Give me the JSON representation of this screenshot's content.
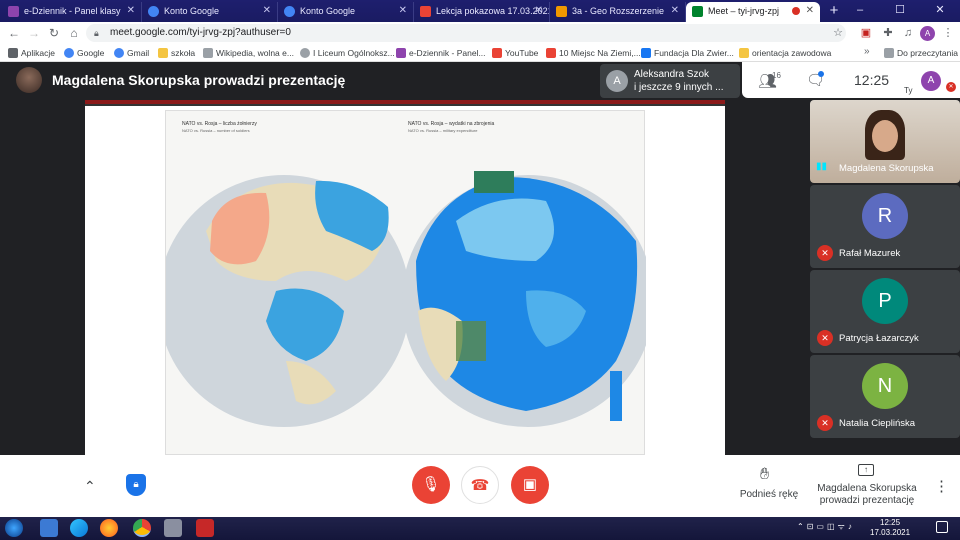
{
  "browser": {
    "tabs": [
      {
        "label": "e-Dziennik - Panel klasy",
        "color": "#8e44ad"
      },
      {
        "label": "Konto Google",
        "color": "#4285f4"
      },
      {
        "label": "Konto Google",
        "color": "#4285f4"
      },
      {
        "label": "Lekcja pokazowa 17.03.2021",
        "color": "#ea4335"
      },
      {
        "label": "3a - Geo Rozszerzenie",
        "color": "#f29900"
      },
      {
        "label": "Meet – tyi-jrvg-zpj",
        "color": "#00832d"
      }
    ],
    "new_tab": "+",
    "window_controls": {
      "minimize": "–",
      "maximize": "☐",
      "close": "✕"
    },
    "url": "meet.google.com/tyi-jrvg-zpj?authuser=0",
    "profile_initial": "A",
    "bookmarks": [
      {
        "label": "Aplikacje",
        "color": "#5f6368"
      },
      {
        "label": "Google",
        "color": "#4285f4"
      },
      {
        "label": "Gmail",
        "color": "#4285f4"
      },
      {
        "label": "szkoła",
        "color": "#f4c542"
      },
      {
        "label": "Wikipedia, wolna e...",
        "color": "#9aa0a6"
      },
      {
        "label": "I Liceum Ogólnoksz...",
        "color": "#9aa0a6"
      },
      {
        "label": "e-Dziennik - Panel...",
        "color": "#8e44ad"
      },
      {
        "label": "YouTube",
        "color": "#ea4335"
      },
      {
        "label": "10 Miejsc Na Ziemi,...",
        "color": "#ea4335"
      },
      {
        "label": "Fundacja Dla Zwier...",
        "color": "#1877f2"
      },
      {
        "label": "orientacja zawodowa",
        "color": "#f4c542"
      }
    ],
    "bookmarks_more": "»",
    "reading_list": "Do przeczytania"
  },
  "meet": {
    "presenter_title": "Magdalena Skorupska prowadzi prezentację",
    "people_pill": {
      "avatar": "A",
      "line1": "Aleksandra Szok",
      "line2": "i jeszcze 9 innych ..."
    },
    "participant_count": "16",
    "clock": "12:25",
    "self_avatar": "A",
    "self_label": "Ty",
    "participants": [
      {
        "name": "Magdalena Skorupska",
        "initial": "",
        "color": "#c9b8a8",
        "muted": false
      },
      {
        "name": "Rafał Mazurek",
        "initial": "R",
        "color": "#5c6bc0",
        "muted": true
      },
      {
        "name": "Patrycja Łazarczyk",
        "initial": "P",
        "color": "#00897b",
        "muted": true
      },
      {
        "name": "Natalia Cieplińska",
        "initial": "N",
        "color": "#7cb342",
        "muted": true
      }
    ],
    "controls": {
      "raise_hand": "Podnieś rękę",
      "presenting_line1": "Magdalena Skorupska",
      "presenting_line2": "prowadzi prezentację"
    }
  },
  "slide": {
    "left_title": "NATO vs. Rosja – liczba żołnierzy",
    "left_subtitle": "NATO vs. Russia – number of soldiers",
    "right_title": "NATO vs. Rosja – wydatki na zbrojenia",
    "right_subtitle": "NATO vs. Russia – military expenditure"
  },
  "taskbar": {
    "time": "12:25",
    "date": "17.03.2021"
  }
}
